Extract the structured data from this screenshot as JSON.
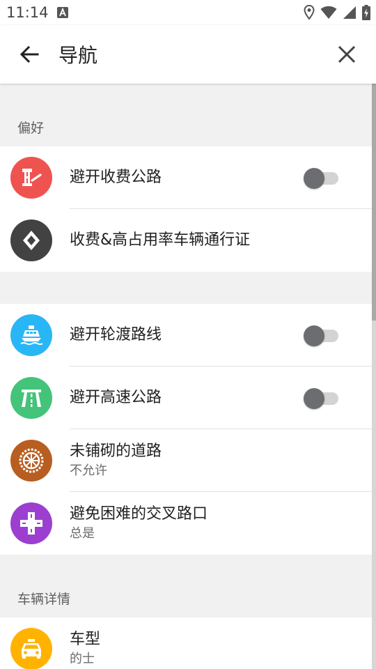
{
  "status_bar": {
    "time": "11:14",
    "icons": [
      "notification-a-icon",
      "location-icon",
      "wifi-icon",
      "signal-icon",
      "battery-charging-icon"
    ]
  },
  "app_bar": {
    "title": "导航",
    "back_icon": "arrow-left-icon",
    "close_icon": "close-icon"
  },
  "sections": {
    "preferences": {
      "header": "偏好",
      "items": [
        {
          "label": "避开收费公路",
          "icon": "toll-gate-icon",
          "icon_color": "#ef5350",
          "toggle_on": false
        },
        {
          "label": "收费&高占用率车辆通行证",
          "icon": "toll-pass-icon",
          "icon_color": "#424242"
        }
      ]
    },
    "avoid": {
      "items": [
        {
          "label": "避开轮渡路线",
          "icon": "ferry-icon",
          "icon_color": "#29b6f6",
          "toggle_on": false
        },
        {
          "label": "避开高速公路",
          "icon": "highway-icon",
          "icon_color": "#43c47a",
          "toggle_on": false
        },
        {
          "label": "未铺砌的道路",
          "sublabel": "不允许",
          "icon": "wheel-icon",
          "icon_color": "#b85e21"
        },
        {
          "label": "避免困难的交叉路口",
          "sublabel": "总是",
          "icon": "intersection-icon",
          "icon_color": "#9c3fd1"
        }
      ]
    },
    "vehicle": {
      "header": "车辆详情",
      "items": [
        {
          "label": "车型",
          "sublabel": "的士",
          "icon": "taxi-icon",
          "icon_color": "#ffb300"
        }
      ]
    }
  },
  "colors": {
    "toggle_off_knob": "#6b6d70",
    "toggle_off_track": "#d3d3d3",
    "background": "#f1f1f1"
  }
}
